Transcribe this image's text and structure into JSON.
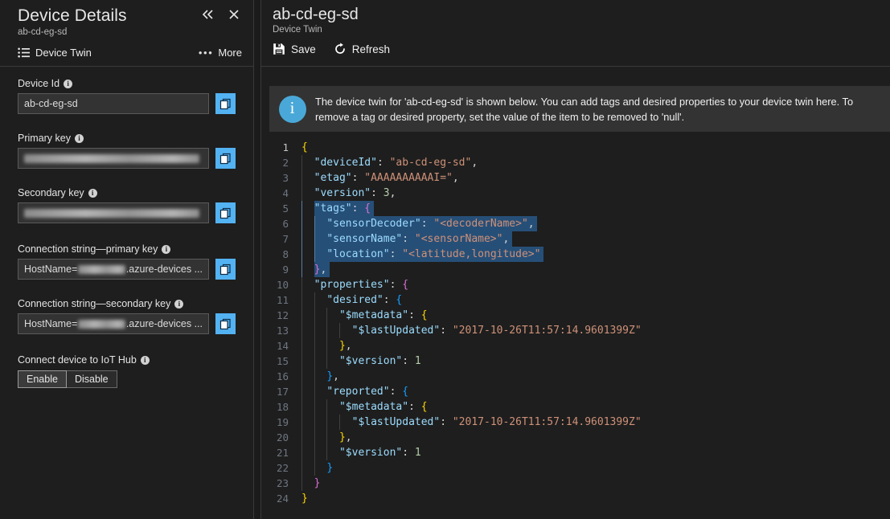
{
  "left_panel": {
    "title": "Device Details",
    "subtitle": "ab-cd-eg-sd",
    "collapse_icon": "chevron-double-left-icon",
    "close_icon": "close-icon",
    "commands": {
      "device_twin": "Device Twin",
      "more": "More",
      "more_dots": "•••"
    },
    "fields": [
      {
        "label": "Device Id",
        "value": "ab-cd-eg-sd",
        "redacted": false,
        "copy_label": "copy-icon"
      },
      {
        "label": "Primary key",
        "value": "",
        "redacted": true,
        "copy_label": "copy-icon"
      },
      {
        "label": "Secondary key",
        "value": "",
        "redacted": true,
        "copy_label": "copy-icon"
      },
      {
        "label": "Connection string—primary key",
        "value_prefix": "HostName=",
        "value_suffix": ".azure-devices ...",
        "redacted": "partial",
        "copy_label": "copy-icon"
      },
      {
        "label": "Connection string—secondary key",
        "value_prefix": "HostName=",
        "value_suffix": ".azure-devices ...",
        "redacted": "partial",
        "copy_label": "copy-icon"
      }
    ],
    "connect_section": {
      "label": "Connect device to IoT Hub",
      "enable_label": "Enable",
      "disable_label": "Disable",
      "selected": "Enable"
    }
  },
  "right_panel": {
    "title": "ab-cd-eg-sd",
    "subtitle": "Device Twin",
    "commands": {
      "save": "Save",
      "refresh": "Refresh"
    },
    "banner": {
      "icon": "info-icon",
      "text": "The device twin for 'ab-cd-eg-sd' is shown below. You can add tags and desired properties to your device twin here. To remove a tag or desired property, set the value of the item to be removed to 'null'."
    },
    "editor": {
      "total_lines": 24,
      "active_line": 1,
      "selection_lines": [
        5,
        6,
        7,
        8,
        9
      ],
      "lines": [
        "{",
        "  \"deviceId\": \"ab-cd-eg-sd\",",
        "  \"etag\": \"AAAAAAAAAAI=\",",
        "  \"version\": 3,",
        "  \"tags\": {",
        "    \"sensorDecoder\": \"<decoderName>\",",
        "    \"sensorName\": \"<sensorName>\",",
        "    \"location\": \"<latitude,longitude>\"",
        "  },",
        "  \"properties\": {",
        "    \"desired\": {",
        "      \"$metadata\": {",
        "        \"$lastUpdated\": \"2017-10-26T11:57:14.9601399Z\"",
        "      },",
        "      \"$version\": 1",
        "    },",
        "    \"reported\": {",
        "      \"$metadata\": {",
        "        \"$lastUpdated\": \"2017-10-26T11:57:14.9601399Z\"",
        "      },",
        "      \"$version\": 1",
        "    }",
        "  }",
        "}"
      ]
    }
  },
  "colors": {
    "accent_blue": "#53b2f2",
    "info_blue": "#4aa8d8",
    "selection_blue": "#264f78",
    "panel_bg": "#1e1e1e",
    "banner_bg": "#333333",
    "string_orange": "#ce9178",
    "key_cyan": "#9cdcfe",
    "number_green": "#b5cea8"
  }
}
